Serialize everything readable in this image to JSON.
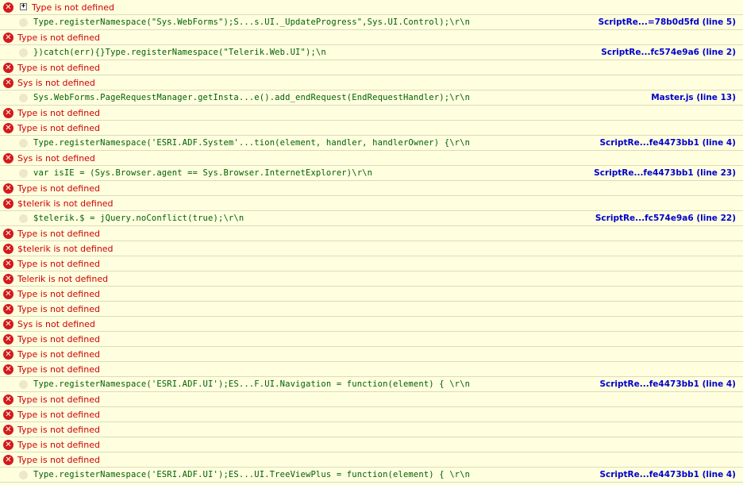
{
  "colors": {
    "background": "#ffffe0",
    "error_text": "#d00000",
    "error_icon": "#d41a1a",
    "code_text": "#006000",
    "link_text": "#0000cc",
    "divider": "#dcdcb8"
  },
  "rows": [
    {
      "type": "error",
      "message": "Type is not defined",
      "expander": true
    },
    {
      "type": "source",
      "code": "Type.registerNamespace(\"Sys.WebForms\");S...s.UI._UpdateProgress\",Sys.UI.Control);\\r\\n",
      "link": "ScriptRe...=78b0d5fd (line 5)"
    },
    {
      "type": "error",
      "message": "Type is not defined"
    },
    {
      "type": "source",
      "code": "})catch(err){}Type.registerNamespace(\"Telerik.Web.UI\");\\n",
      "link": "ScriptRe...fc574e9a6 (line 2)"
    },
    {
      "type": "error",
      "message": "Type is not defined"
    },
    {
      "type": "error",
      "message": "Sys is not defined"
    },
    {
      "type": "source",
      "code": "Sys.WebForms.PageRequestManager.getInsta...e().add_endRequest(EndRequestHandler);\\r\\n",
      "link": "Master.js (line 13)"
    },
    {
      "type": "error",
      "message": "Type is not defined"
    },
    {
      "type": "error",
      "message": "Type is not defined"
    },
    {
      "type": "source",
      "code": "Type.registerNamespace('ESRI.ADF.System'...tion(element, handler, handlerOwner) {\\r\\n",
      "link": "ScriptRe...fe4473bb1 (line 4)"
    },
    {
      "type": "error",
      "message": "Sys is not defined"
    },
    {
      "type": "source",
      "code": "var isIE = (Sys.Browser.agent == Sys.Browser.InternetExplorer)\\r\\n",
      "link": "ScriptRe...fe4473bb1 (line 23)"
    },
    {
      "type": "error",
      "message": "Type is not defined"
    },
    {
      "type": "error",
      "message": "$telerik is not defined"
    },
    {
      "type": "source",
      "code": "$telerik.$ = jQuery.noConflict(true);\\r\\n",
      "link": "ScriptRe...fc574e9a6 (line 22)"
    },
    {
      "type": "error",
      "message": "Type is not defined"
    },
    {
      "type": "error",
      "message": "$telerik is not defined"
    },
    {
      "type": "error",
      "message": "Type is not defined"
    },
    {
      "type": "error",
      "message": "Telerik is not defined"
    },
    {
      "type": "error",
      "message": "Type is not defined"
    },
    {
      "type": "error",
      "message": "Type is not defined"
    },
    {
      "type": "error",
      "message": "Sys is not defined"
    },
    {
      "type": "error",
      "message": "Type is not defined"
    },
    {
      "type": "error",
      "message": "Type is not defined"
    },
    {
      "type": "error",
      "message": "Type is not defined"
    },
    {
      "type": "source",
      "code": "Type.registerNamespace('ESRI.ADF.UI');ES...F.UI.Navigation = function(element) { \\r\\n",
      "link": "ScriptRe...fe4473bb1 (line 4)"
    },
    {
      "type": "error",
      "message": "Type is not defined"
    },
    {
      "type": "error",
      "message": "Type is not defined"
    },
    {
      "type": "error",
      "message": "Type is not defined"
    },
    {
      "type": "error",
      "message": "Type is not defined"
    },
    {
      "type": "error",
      "message": "Type is not defined"
    },
    {
      "type": "source",
      "code": "Type.registerNamespace('ESRI.ADF.UI');ES...UI.TreeViewPlus = function(element) { \\r\\n",
      "link": "ScriptRe...fe4473bb1 (line 4)"
    }
  ]
}
